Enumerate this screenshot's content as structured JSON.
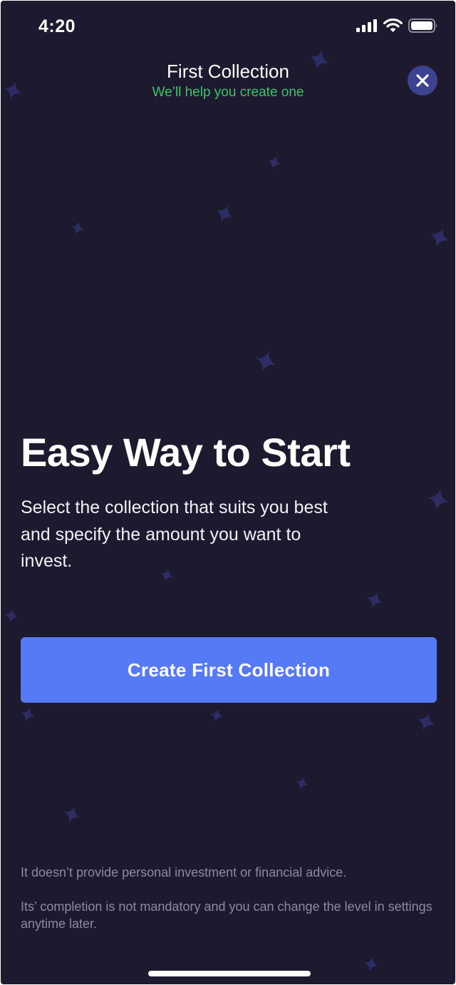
{
  "status_bar": {
    "time": "4:20"
  },
  "header": {
    "title": "First Collection",
    "subtitle": "We’ll help you create one"
  },
  "main": {
    "headline": "Easy Way to Start",
    "description": "Select the collection that suits you best and specify the amount you want to invest.",
    "cta_label": "Create First Collection"
  },
  "footer": {
    "disclaimer_1": "It doesn’t provide personal investment or financial advice.",
    "disclaimer_2": "Its’ completion is not mandatory and you can change the level in settings anytime later."
  },
  "icons": {
    "close": "close-icon",
    "signal": "cellular-signal-icon",
    "wifi": "wifi-icon",
    "battery": "battery-icon",
    "star": "sparkle-star-icon"
  },
  "colors": {
    "background": "#1d192f",
    "accent": "#5679f6",
    "subtitle_green": "#35c76a",
    "close_bg": "#3e4390",
    "star": "#2e2d63",
    "muted_text": "#8d8aa0"
  }
}
